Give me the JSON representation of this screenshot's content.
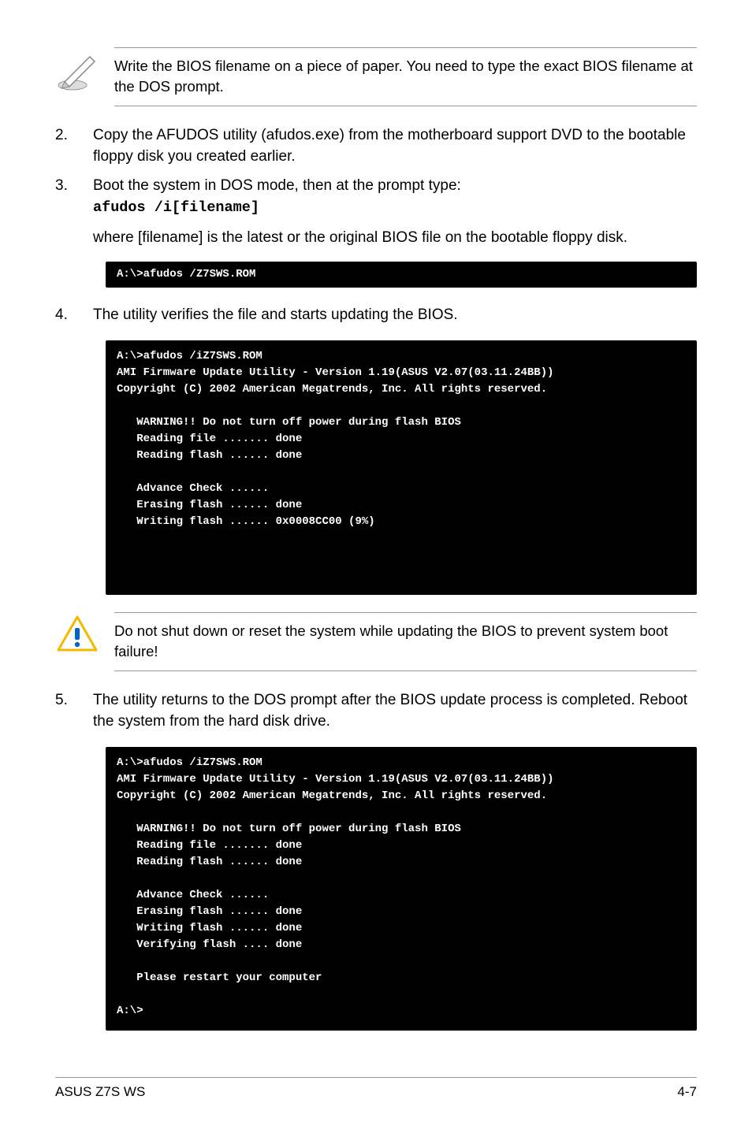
{
  "note1": "Write the BIOS filename on a piece of paper. You need to type the exact BIOS filename at the DOS prompt.",
  "steps": {
    "2": {
      "num": "2.",
      "text": "Copy the AFUDOS utility (afudos.exe) from the motherboard support DVD to the bootable floppy disk you created earlier."
    },
    "3": {
      "num": "3.",
      "text": "Boot the system in DOS mode, then at the prompt type:",
      "code": "afudos /i[filename]"
    },
    "4": {
      "num": "4.",
      "text": "The utility verifies the file and starts updating the BIOS."
    },
    "5": {
      "num": "5.",
      "text": "The utility returns to the DOS prompt after the BIOS update process is completed. Reboot the system from the hard disk drive."
    }
  },
  "para_where": "where [filename] is the latest or the original BIOS file on the bootable floppy disk.",
  "term1": "A:\\>afudos /Z7SWS.ROM",
  "term2": "A:\\>afudos /iZ7SWS.ROM\nAMI Firmware Update Utility - Version 1.19(ASUS V2.07(03.11.24BB))\nCopyright (C) 2002 American Megatrends, Inc. All rights reserved.\n\n   WARNING!! Do not turn off power during flash BIOS\n   Reading file ....... done\n   Reading flash ...... done\n\n   Advance Check ......\n   Erasing flash ...... done\n   Writing flash ...... 0x0008CC00 (9%)\n\n\n",
  "caution": "Do not shut down or reset the system while updating the BIOS to prevent system boot failure!",
  "term3": "A:\\>afudos /iZ7SWS.ROM\nAMI Firmware Update Utility - Version 1.19(ASUS V2.07(03.11.24BB))\nCopyright (C) 2002 American Megatrends, Inc. All rights reserved.\n\n   WARNING!! Do not turn off power during flash BIOS\n   Reading file ....... done\n   Reading flash ...... done\n\n   Advance Check ......\n   Erasing flash ...... done\n   Writing flash ...... done\n   Verifying flash .... done\n\n   Please restart your computer\n\nA:\\>",
  "footer": {
    "left": "ASUS Z7S WS",
    "right": "4-7"
  }
}
